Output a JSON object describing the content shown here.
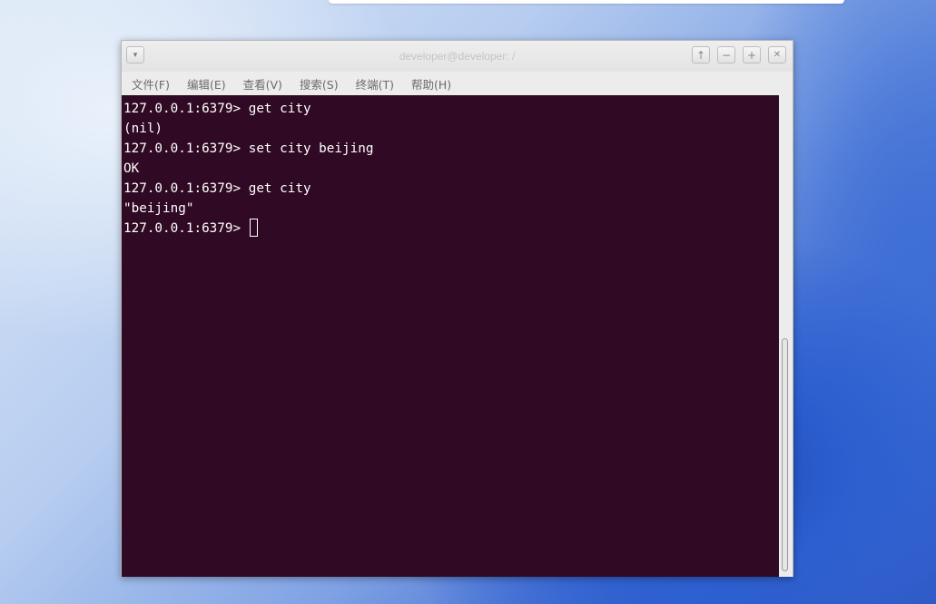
{
  "window": {
    "title": "developer@developer: /",
    "menu_button_icon": "chevron-down-icon",
    "controls": [
      {
        "name": "keep-above",
        "glyph": "↑"
      },
      {
        "name": "minimize",
        "glyph": "−"
      },
      {
        "name": "maximize",
        "glyph": "+"
      },
      {
        "name": "close",
        "glyph": "✕"
      }
    ]
  },
  "menubar": {
    "file": "文件(F)",
    "edit": "编辑(E)",
    "view": "查看(V)",
    "search": "搜索(S)",
    "terminal": "终端(T)",
    "help": "帮助(H)"
  },
  "terminal": {
    "background": "#300a24",
    "foreground": "#ffffff",
    "lines": [
      "127.0.0.1:6379> get city",
      "(nil)",
      "127.0.0.1:6379> set city beijing",
      "OK",
      "127.0.0.1:6379> get city",
      "\"beijing\"",
      "127.0.0.1:6379> "
    ]
  }
}
